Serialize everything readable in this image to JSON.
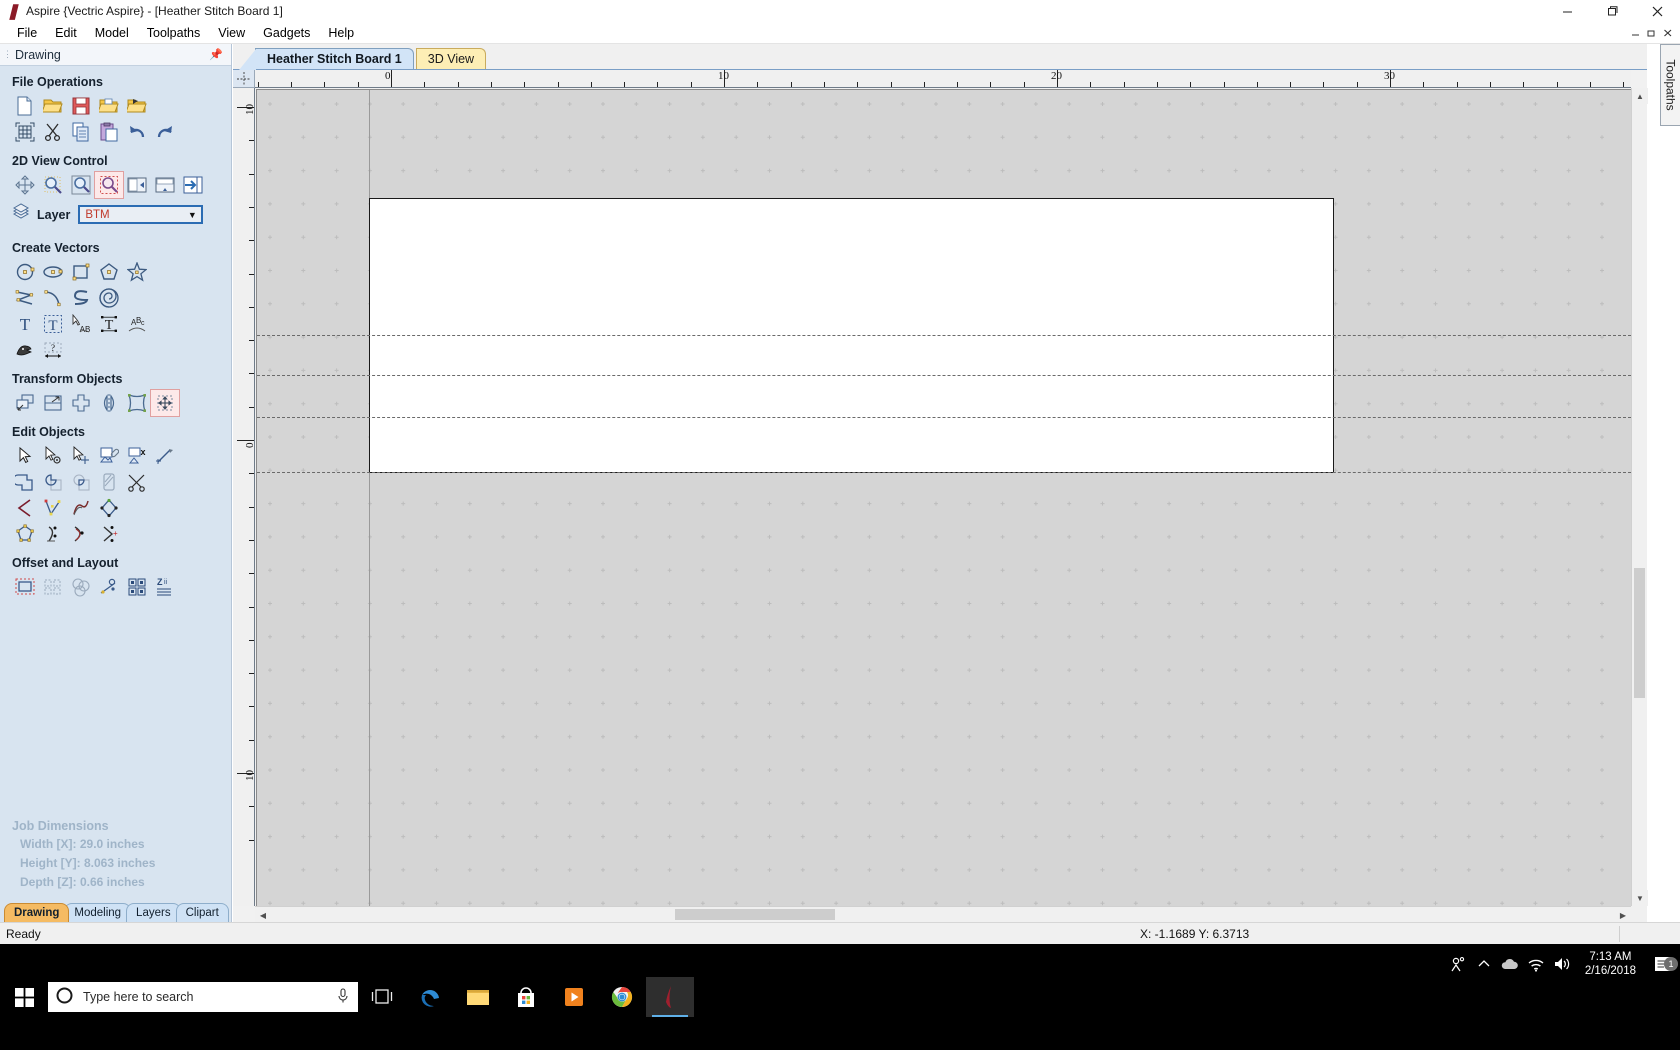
{
  "window": {
    "title": "Aspire {Vectric Aspire} - [Heather Stitch Board 1]",
    "app_icon": "aspire-flame-icon",
    "minimize": "—",
    "maximize": "❐",
    "close": "✕"
  },
  "menu": {
    "items": [
      {
        "label": "File"
      },
      {
        "label": "Edit"
      },
      {
        "label": "Model"
      },
      {
        "label": "Toolpaths"
      },
      {
        "label": "View"
      },
      {
        "label": "Gadgets"
      },
      {
        "label": "Help"
      }
    ]
  },
  "left_panel": {
    "title": "Drawing",
    "pin_icon": "pin-icon",
    "sections": [
      {
        "title": "File Operations",
        "rows": [
          [
            {
              "name": "new-file-icon",
              "tip": "New File"
            },
            {
              "name": "open-file-icon",
              "tip": "Open File"
            },
            {
              "name": "save-file-icon",
              "tip": "Save File"
            },
            {
              "name": "import-vectors-icon",
              "tip": "Import Vectors"
            },
            {
              "name": "import-bitmap-icon",
              "tip": "Import Bitmap"
            }
          ],
          [
            {
              "name": "job-setup-icon",
              "tip": "Job Setup"
            },
            {
              "name": "cut-icon",
              "tip": "Cut"
            },
            {
              "name": "copy-icon",
              "tip": "Copy"
            },
            {
              "name": "paste-icon",
              "tip": "Paste"
            },
            {
              "name": "undo-icon",
              "tip": "Undo"
            },
            {
              "name": "redo-icon",
              "tip": "Redo"
            }
          ]
        ]
      },
      {
        "title": "2D View Control",
        "rows": [
          [
            {
              "name": "pan-view-icon",
              "tip": "Pan View"
            },
            {
              "name": "zoom-interactive-icon",
              "tip": "Zoom Interactive"
            },
            {
              "name": "zoom-extents-icon",
              "tip": "Zoom Extents"
            },
            {
              "name": "zoom-selection-icon",
              "tip": "Zoom Selection",
              "selected": true
            },
            {
              "name": "toggle-left-pane-icon",
              "tip": "Toggle Pane"
            },
            {
              "name": "toggle-top-pane-icon",
              "tip": "Toggle Pane"
            },
            {
              "name": "maximize-2d-view-icon",
              "tip": "Maximize 2D View"
            }
          ]
        ]
      }
    ],
    "layer": {
      "icon": "layers-icon",
      "label": "Layer",
      "value": "BTM",
      "arrow": "▼"
    },
    "create_vectors": {
      "title": "Create Vectors",
      "rows": [
        [
          {
            "name": "draw-circle-icon"
          },
          {
            "name": "draw-ellipse-icon"
          },
          {
            "name": "draw-rectangle-icon"
          },
          {
            "name": "draw-polygon-icon"
          },
          {
            "name": "draw-star-icon"
          }
        ],
        [
          {
            "name": "draw-polyline-icon"
          },
          {
            "name": "draw-arc-icon"
          },
          {
            "name": "draw-curve-icon"
          },
          {
            "name": "draw-spiral-icon"
          }
        ],
        [
          {
            "name": "create-text-icon"
          },
          {
            "name": "text-in-box-icon"
          },
          {
            "name": "text-on-curve-icon"
          },
          {
            "name": "auto-text-layout-icon"
          },
          {
            "name": "text-on-arc-icon"
          }
        ],
        [
          {
            "name": "trace-bitmap-icon"
          },
          {
            "name": "dimension-tool-icon"
          }
        ]
      ]
    },
    "transform_objects": {
      "title": "Transform Objects",
      "rows": [
        [
          {
            "name": "move-object-icon"
          },
          {
            "name": "scale-object-icon"
          },
          {
            "name": "rotate-object-icon"
          },
          {
            "name": "mirror-object-icon"
          },
          {
            "name": "distort-object-icon"
          },
          {
            "name": "align-objects-icon",
            "selected": true
          }
        ]
      ]
    },
    "edit_objects": {
      "title": "Edit Objects",
      "rows": [
        [
          {
            "name": "select-vectors-icon"
          },
          {
            "name": "node-edit-icon"
          },
          {
            "name": "move-nodes-icon"
          },
          {
            "name": "group-objects-icon"
          },
          {
            "name": "ungroup-objects-icon"
          },
          {
            "name": "measure-icon"
          }
        ],
        [
          {
            "name": "weld-vectors-icon"
          },
          {
            "name": "subtract-vectors-icon"
          },
          {
            "name": "intersect-vectors-icon"
          },
          {
            "name": "fill-vectors-icon"
          },
          {
            "name": "trim-vectors-icon"
          }
        ],
        [
          {
            "name": "join-vectors-icon"
          },
          {
            "name": "fit-curves-icon"
          },
          {
            "name": "smooth-vectors-icon"
          },
          {
            "name": "offset-nodes-icon"
          }
        ],
        [
          {
            "name": "close-vector-icon"
          },
          {
            "name": "start-node-icon"
          },
          {
            "name": "curve-node-icon"
          },
          {
            "name": "insert-node-icon"
          }
        ]
      ]
    },
    "offset_layout": {
      "title": "Offset and Layout",
      "rows": [
        [
          {
            "name": "offset-vectors-icon"
          },
          {
            "name": "array-copy-icon"
          },
          {
            "name": "block-copy-icon"
          },
          {
            "name": "copy-along-curve-icon"
          },
          {
            "name": "nesting-icon"
          },
          {
            "name": "texture-toolpath-icon"
          }
        ]
      ]
    },
    "job_dimensions": {
      "title": "Job Dimensions",
      "width": "Width  [X]: 29.0 inches",
      "height": "Height [Y]: 8.063 inches",
      "depth": "Depth  [Z]: 0.66 inches"
    },
    "tabs": [
      {
        "label": "Drawing",
        "active": true
      },
      {
        "label": "Modeling",
        "active": false
      },
      {
        "label": "Layers",
        "active": false
      },
      {
        "label": "Clipart",
        "active": false
      }
    ]
  },
  "document_tabs": [
    {
      "label": "Heather Stitch Board 1",
      "active": true
    },
    {
      "label": "3D View",
      "active": false
    }
  ],
  "rulers": {
    "horizontal_labels": [
      "0",
      "10",
      "20",
      "30"
    ],
    "vertical_labels": [
      "10",
      "0",
      "10"
    ],
    "units": "inches"
  },
  "right_dock": {
    "label": "Toolpaths"
  },
  "statusbar": {
    "message": "Ready",
    "coordinates": "X: -1.1689 Y:  6.3713"
  },
  "taskbar": {
    "start_icon": "windows-start-icon",
    "search_placeholder": "Type here to search",
    "search_icon": "cortana-circle-icon",
    "mic_icon": "microphone-icon",
    "apps": [
      {
        "name": "task-view-icon",
        "label": "Task View"
      },
      {
        "name": "edge-browser-icon",
        "label": "Microsoft Edge"
      },
      {
        "name": "file-explorer-icon",
        "label": "File Explorer"
      },
      {
        "name": "microsoft-store-icon",
        "label": "Microsoft Store"
      },
      {
        "name": "movies-tv-icon",
        "label": "Movies & TV"
      },
      {
        "name": "chrome-browser-icon",
        "label": "Google Chrome"
      },
      {
        "name": "aspire-app-icon",
        "label": "Vectric Aspire",
        "active": true
      }
    ],
    "tray": [
      {
        "name": "people-icon"
      },
      {
        "name": "show-hidden-icons-chevron"
      },
      {
        "name": "onedrive-cloud-icon"
      },
      {
        "name": "wifi-icon"
      },
      {
        "name": "volume-icon"
      }
    ],
    "clock_time": "7:13 AM",
    "clock_date": "2/16/2018",
    "notification_icon": "action-center-icon",
    "notification_count": "1"
  },
  "colors": {
    "panel_bg": "#d8e4f0",
    "accent_blue": "#2b6cb3",
    "layer_text": "#c0392b",
    "active_tab": "#f5bb63",
    "doc_tab_active": "#d2e4f7",
    "doc_tab_yellow": "#fdeeb5",
    "canvas_bg": "#d5d5d5",
    "job_fill": "#ffffff"
  }
}
